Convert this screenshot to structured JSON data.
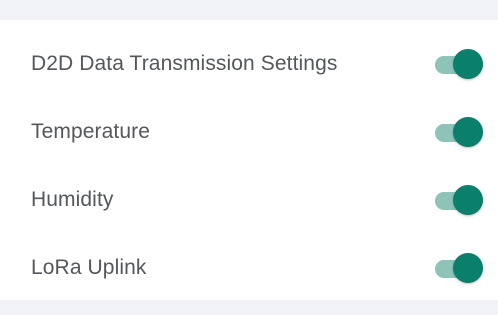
{
  "settings": {
    "items": [
      {
        "label": "D2D Data Transmission Settings",
        "enabled": true
      },
      {
        "label": "Temperature",
        "enabled": true
      },
      {
        "label": "Humidity",
        "enabled": true
      },
      {
        "label": "LoRa Uplink",
        "enabled": true
      }
    ]
  },
  "colors": {
    "background": "#f2f3f6",
    "card": "#ffffff",
    "label_text": "#54575c",
    "toggle_track_on": "#8ec4b8",
    "toggle_thumb_on": "#0a7f6b"
  }
}
